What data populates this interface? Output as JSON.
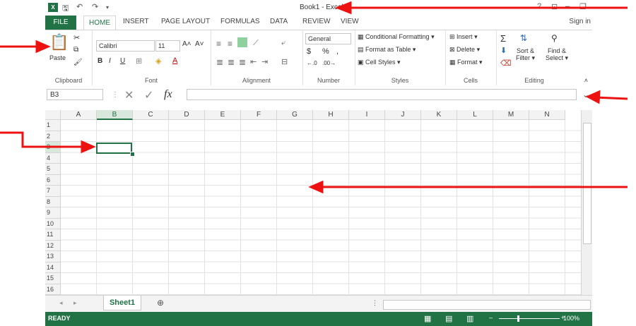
{
  "titlebar": {
    "logo": "X",
    "title": "Book1 - Excel",
    "help": "?",
    "ribbon_opts": "⊡",
    "minimize": "–",
    "restore": "❐",
    "close": "✕"
  },
  "tabs": [
    "FILE",
    "HOME",
    "INSERT",
    "PAGE LAYOUT",
    "FORMULAS",
    "DATA",
    "REVIEW",
    "VIEW"
  ],
  "signin": "Sign in",
  "ribbon": {
    "clipboard": {
      "paste": "Paste",
      "label": "Clipboard"
    },
    "font": {
      "name": "Calibri",
      "size": "11",
      "label": "Font"
    },
    "alignment": {
      "label": "Alignment"
    },
    "number": {
      "format": "General",
      "label": "Number"
    },
    "styles": {
      "cond": "Conditional Formatting",
      "table": "Format as Table",
      "cell": "Cell Styles",
      "label": "Styles"
    },
    "cells": {
      "insert": "Insert",
      "delete": "Delete",
      "format": "Format",
      "label": "Cells"
    },
    "editing": {
      "sort": "Sort &",
      "filter": "Filter",
      "find": "Find &",
      "select": "Select",
      "label": "Editing"
    }
  },
  "formula_bar": {
    "name_box": "B3",
    "fx": "fx"
  },
  "grid": {
    "columns": [
      "A",
      "B",
      "C",
      "D",
      "E",
      "F",
      "G",
      "H",
      "I",
      "J",
      "K",
      "L",
      "M",
      "N"
    ],
    "rows": [
      "1",
      "2",
      "3",
      "4",
      "5",
      "6",
      "7",
      "8",
      "9",
      "10",
      "11",
      "12",
      "13",
      "14",
      "15",
      "16"
    ],
    "selected": "B3"
  },
  "sheets": [
    "Sheet1"
  ],
  "status": {
    "text": "READY",
    "zoom": "100%"
  },
  "colors": {
    "excel_green": "#217346",
    "annotation_red": "#ee1111"
  }
}
